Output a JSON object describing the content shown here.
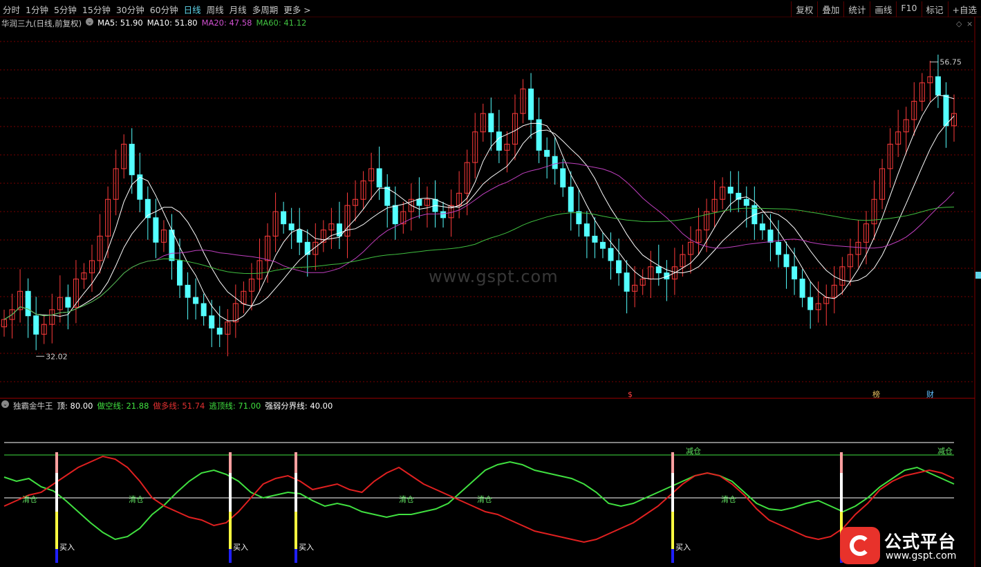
{
  "toolbar": {
    "periods": [
      "分时",
      "1分钟",
      "5分钟",
      "15分钟",
      "30分钟",
      "60分钟",
      "日线",
      "周线",
      "月线",
      "多周期",
      "更多 >"
    ],
    "active_period": "日线",
    "right_buttons": [
      "复权",
      "叠加",
      "统计",
      "画线",
      "F10",
      "标记",
      "+自选"
    ]
  },
  "main_legend": {
    "title": "华润三九(日线,前复权)",
    "ma5": "MA5: 51.90",
    "ma10": "MA10: 51.80",
    "ma20": "MA20: 47.58",
    "ma60": "MA60: 41.12"
  },
  "indicator_legend": {
    "name": "独霸金牛王",
    "top": "顶: 80.00",
    "bear": "做空线: 21.88",
    "bull": "做多线: 51.74",
    "escape": "逃顶线: 71.00",
    "divide": "强弱分界线: 40.00"
  },
  "watermark": "www.gspt.com",
  "logo": {
    "name": "公式平台",
    "url": "www.gspt.com"
  },
  "colors": {
    "up": "#ff3b3b",
    "down": "#54ffff",
    "ma5": "#ffffff",
    "ma10": "#ffffff",
    "ma20": "#c040c0",
    "ma60": "#40c040",
    "bull": "#e02020",
    "bear": "#40e040"
  },
  "chart_data": [
    {
      "type": "candlestick",
      "title": "华润三九(日线,前复权)",
      "ylim": [
        30,
        60
      ],
      "max_label": "56.75",
      "min_label": "32.02",
      "event_marks": [
        "$",
        "榜",
        "财"
      ],
      "close": [
        36.2,
        37.0,
        38.5,
        36.5,
        35.0,
        35.8,
        37.0,
        38.0,
        37.2,
        39.5,
        40.0,
        41.0,
        43.0,
        46.0,
        48.5,
        50.5,
        48.0,
        46.0,
        44.5,
        42.5,
        43.5,
        41.0,
        39.0,
        38.0,
        37.5,
        36.5,
        35.5,
        35.0,
        36.0,
        37.5,
        38.5,
        39.5,
        41.0,
        43.0,
        45.0,
        44.0,
        43.5,
        42.5,
        41.5,
        42.5,
        43.5,
        44.0,
        43.0,
        45.5,
        46.0,
        47.5,
        48.5,
        47.0,
        45.5,
        44.0,
        45.0,
        46.0,
        45.5,
        46.0,
        45.0,
        44.5,
        45.5,
        46.5,
        49.0,
        51.5,
        53.0,
        51.5,
        50.0,
        50.5,
        53.0,
        55.0,
        52.5,
        50.0,
        49.5,
        48.5,
        47.0,
        45.0,
        44.0,
        43.0,
        42.5,
        42.0,
        41.0,
        40.0,
        38.5,
        39.0,
        39.5,
        40.5,
        40.0,
        39.5,
        40.5,
        41.5,
        42.5,
        43.5,
        45.0,
        46.0,
        47.0,
        46.5,
        46.0,
        45.5,
        44.0,
        43.5,
        42.5,
        41.5,
        40.5,
        39.5,
        38.0,
        37.0,
        37.5,
        38.0,
        39.0,
        40.5,
        41.5,
        42.5,
        44.0,
        46.0,
        48.5,
        50.5,
        51.5,
        52.5,
        54.0,
        55.5,
        56.0,
        54.5,
        52.0,
        53.0
      ]
    },
    {
      "type": "line",
      "title": "独霸金牛王",
      "ylim": [
        0,
        100
      ],
      "series": [
        {
          "name": "做空线",
          "values": [
            55,
            52,
            54,
            48,
            45,
            38,
            30,
            22,
            15,
            10,
            12,
            18,
            28,
            35,
            44,
            52,
            58,
            60,
            57,
            52,
            44,
            40,
            42,
            44,
            43,
            38,
            34,
            36,
            34,
            30,
            28,
            26,
            28,
            28,
            30,
            32,
            36,
            44,
            52,
            60,
            64,
            66,
            64,
            60,
            58,
            56,
            54,
            50,
            44,
            36,
            34,
            36,
            40,
            44,
            48,
            52,
            56,
            58,
            56,
            52,
            44,
            36,
            32,
            31,
            33,
            36,
            38,
            34,
            30,
            34,
            40,
            48,
            54,
            60,
            62,
            58,
            54,
            50
          ]
        },
        {
          "name": "做多线",
          "values": [
            34,
            38,
            42,
            44,
            50,
            56,
            62,
            66,
            70,
            68,
            62,
            52,
            40,
            34,
            30,
            26,
            24,
            20,
            22,
            30,
            40,
            50,
            54,
            56,
            52,
            46,
            48,
            50,
            46,
            44,
            52,
            58,
            62,
            56,
            50,
            46,
            42,
            38,
            34,
            30,
            28,
            24,
            20,
            16,
            14,
            12,
            10,
            8,
            10,
            14,
            18,
            22,
            28,
            34,
            42,
            50,
            56,
            58,
            56,
            50,
            42,
            32,
            24,
            20,
            16,
            12,
            10,
            12,
            18,
            28,
            36,
            46,
            52,
            56,
            58,
            60,
            58,
            54
          ]
        }
      ],
      "labels": [
        "清仓",
        "减仓",
        "买入"
      ]
    }
  ]
}
